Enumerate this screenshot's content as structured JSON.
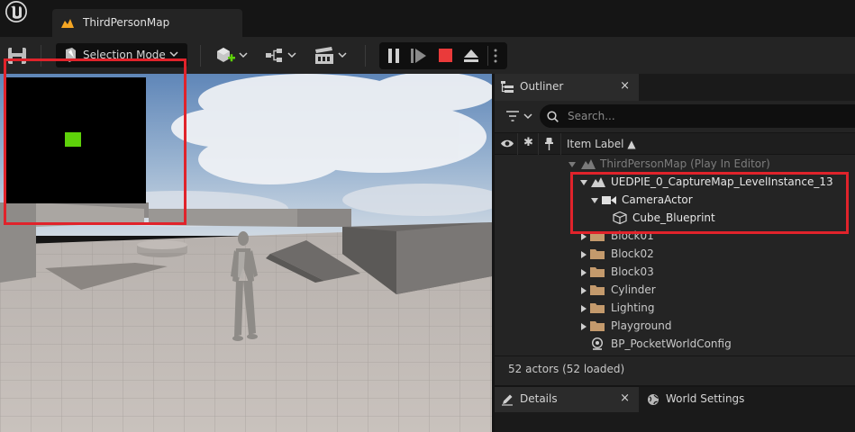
{
  "titlebar": {
    "tab_title": "ThirdPersonMap"
  },
  "toolbar": {
    "mode_label": "Selection Mode"
  },
  "outliner": {
    "tab_label": "Outliner",
    "close_glyph": "×",
    "search_placeholder": "Search...",
    "column_header": "Item Label ▲",
    "rows": [
      {
        "label": "ThirdPersonMap (Play In Editor)",
        "icon": "level-icon",
        "expanded": true,
        "dimmed": true
      },
      {
        "label": "UEDPIE_0_CaptureMap_LevelInstance_13",
        "icon": "level-icon",
        "expanded": true
      },
      {
        "label": "CameraActor",
        "icon": "camera-icon",
        "expanded": true
      },
      {
        "label": "Cube_Blueprint",
        "icon": "cube-icon"
      },
      {
        "label": "Block01",
        "icon": "folder-icon",
        "expanded": false
      },
      {
        "label": "Block02",
        "icon": "folder-icon",
        "expanded": false
      },
      {
        "label": "Block03",
        "icon": "folder-icon",
        "expanded": false
      },
      {
        "label": "Cylinder",
        "icon": "folder-icon",
        "expanded": false
      },
      {
        "label": "Lighting",
        "icon": "folder-icon",
        "expanded": false
      },
      {
        "label": "Playground",
        "icon": "folder-icon",
        "expanded": false
      },
      {
        "label": "BP_PocketWorldConfig",
        "icon": "actor-icon"
      }
    ],
    "status": "52 actors (52 loaded)"
  },
  "bottom_tabs": {
    "details_label": "Details",
    "world_settings_label": "World Settings"
  },
  "colors": {
    "highlight": "#e0232b",
    "stop": "#ea3a3a",
    "cube_green": "#5ed10a",
    "map_icon": "#f5a623"
  }
}
